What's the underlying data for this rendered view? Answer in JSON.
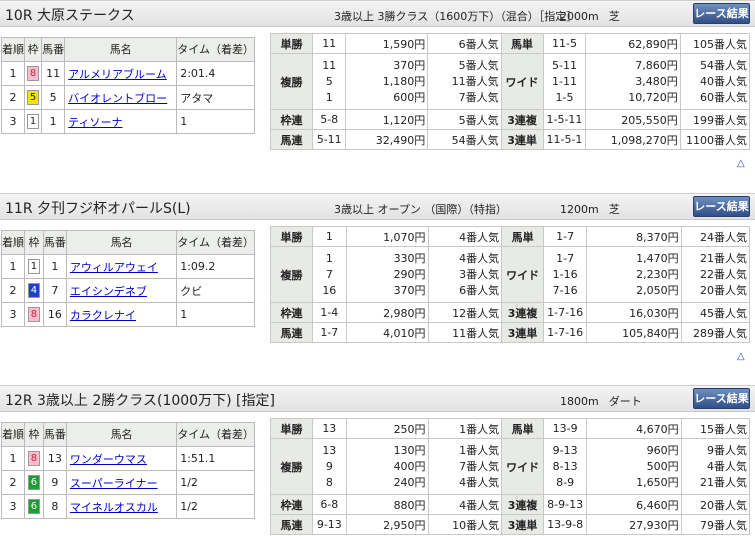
{
  "race_button": "レース結果",
  "headers": {
    "rank": "着順",
    "waku": "枠",
    "num": "馬番",
    "horse": "馬名",
    "time": "タイム（着差）"
  },
  "pay_labels": {
    "tansho": "単勝",
    "fukusho": "複勝",
    "wakuren": "枠連",
    "umaren": "馬連",
    "umatan": "馬単",
    "wide": "ワイド",
    "sanrenpuku": "3連複",
    "sanrentan": "3連単"
  },
  "toggle_icon": "△",
  "races": [
    {
      "name": "10R 大原ステークス",
      "cond": "3歳以上 3勝クラス（1600万下）（混合）［指定］",
      "distance": "2000m",
      "surface": "芝",
      "results": [
        {
          "rank": "1",
          "waku": "8",
          "num": "11",
          "horse": "アルメリアブルーム",
          "time": "2:01.4"
        },
        {
          "rank": "2",
          "waku": "5",
          "num": "5",
          "horse": "バイオレントブロー",
          "time": "アタマ"
        },
        {
          "rank": "3",
          "waku": "1",
          "num": "1",
          "horse": "ティソーナ",
          "time": "1"
        }
      ],
      "pay": {
        "tansho": {
          "c": "11",
          "y": "1,590円",
          "p": "6番人気"
        },
        "fukusho": {
          "c": [
            "11",
            "5",
            "1"
          ],
          "y": [
            "370円",
            "1,180円",
            "600円"
          ],
          "p": [
            "5番人気",
            "11番人気",
            "7番人気"
          ]
        },
        "wakuren": {
          "c": "5-8",
          "y": "1,120円",
          "p": "5番人気"
        },
        "umaren": {
          "c": "5-11",
          "y": "32,490円",
          "p": "54番人気"
        },
        "umatan": {
          "c": "11-5",
          "y": "62,890円",
          "p": "105番人気"
        },
        "wide": {
          "c": [
            "5-11",
            "1-11",
            "1-5"
          ],
          "y": [
            "7,860円",
            "3,480円",
            "10,720円"
          ],
          "p": [
            "54番人気",
            "40番人気",
            "60番人気"
          ]
        },
        "sanrenpuku": {
          "c": "1-5-11",
          "y": "205,550円",
          "p": "199番人気"
        },
        "sanrentan": {
          "c": "11-5-1",
          "y": "1,098,270円",
          "p": "1100番人気"
        }
      }
    },
    {
      "name": "11R 夕刊フジ杯オパールS(L)",
      "cond": "3歳以上 オープン （国際）（特指）",
      "distance": "1200m",
      "surface": "芝",
      "results": [
        {
          "rank": "1",
          "waku": "1",
          "num": "1",
          "horse": "アウィルアウェイ",
          "time": "1:09.2"
        },
        {
          "rank": "2",
          "waku": "4",
          "num": "7",
          "horse": "エイシンデネブ",
          "time": "クビ"
        },
        {
          "rank": "3",
          "waku": "8",
          "num": "16",
          "horse": "カラクレナイ",
          "time": "1"
        }
      ],
      "pay": {
        "tansho": {
          "c": "1",
          "y": "1,070円",
          "p": "4番人気"
        },
        "fukusho": {
          "c": [
            "1",
            "7",
            "16"
          ],
          "y": [
            "330円",
            "290円",
            "370円"
          ],
          "p": [
            "4番人気",
            "3番人気",
            "6番人気"
          ]
        },
        "wakuren": {
          "c": "1-4",
          "y": "2,980円",
          "p": "12番人気"
        },
        "umaren": {
          "c": "1-7",
          "y": "4,010円",
          "p": "11番人気"
        },
        "umatan": {
          "c": "1-7",
          "y": "8,370円",
          "p": "24番人気"
        },
        "wide": {
          "c": [
            "1-7",
            "1-16",
            "7-16"
          ],
          "y": [
            "1,470円",
            "2,230円",
            "2,050円"
          ],
          "p": [
            "21番人気",
            "22番人気",
            "20番人気"
          ]
        },
        "sanrenpuku": {
          "c": "1-7-16",
          "y": "16,030円",
          "p": "45番人気"
        },
        "sanrentan": {
          "c": "1-7-16",
          "y": "105,840円",
          "p": "289番人気"
        }
      }
    },
    {
      "name": "12R 3歳以上 2勝クラス(1000万下) [指定]",
      "cond": "",
      "distance": "1800m",
      "surface": "ダート",
      "results": [
        {
          "rank": "1",
          "waku": "8",
          "num": "13",
          "horse": "ワンダーウマス",
          "time": "1:51.1"
        },
        {
          "rank": "2",
          "waku": "6",
          "num": "9",
          "horse": "スーパーライナー",
          "time": "1/2"
        },
        {
          "rank": "3",
          "waku": "6",
          "num": "8",
          "horse": "マイネルオスカル",
          "time": "1/2"
        }
      ],
      "pay": {
        "tansho": {
          "c": "13",
          "y": "250円",
          "p": "1番人気"
        },
        "fukusho": {
          "c": [
            "13",
            "9",
            "8"
          ],
          "y": [
            "130円",
            "400円",
            "240円"
          ],
          "p": [
            "1番人気",
            "7番人気",
            "4番人気"
          ]
        },
        "wakuren": {
          "c": "6-8",
          "y": "880円",
          "p": "4番人気"
        },
        "umaren": {
          "c": "9-13",
          "y": "2,950円",
          "p": "10番人気"
        },
        "umatan": {
          "c": "13-9",
          "y": "4,670円",
          "p": "15番人気"
        },
        "wide": {
          "c": [
            "9-13",
            "8-13",
            "8-9"
          ],
          "y": [
            "960円",
            "500円",
            "1,650円"
          ],
          "p": [
            "9番人気",
            "4番人気",
            "21番人気"
          ]
        },
        "sanrenpuku": {
          "c": "8-9-13",
          "y": "6,460円",
          "p": "20番人気"
        },
        "sanrentan": {
          "c": "13-9-8",
          "y": "27,930円",
          "p": "79番人気"
        }
      }
    }
  ],
  "waku_colors": {
    "1": {
      "bg": "#ffffff",
      "fg": "#222222"
    },
    "4": {
      "bg": "#1a3fcc",
      "fg": "#ffffff"
    },
    "5": {
      "bg": "#f2e600",
      "fg": "#222222"
    },
    "6": {
      "bg": "#17a02b",
      "fg": "#ffffff"
    },
    "8": {
      "bg": "#f7bfcf",
      "fg": "#cc2244"
    }
  }
}
